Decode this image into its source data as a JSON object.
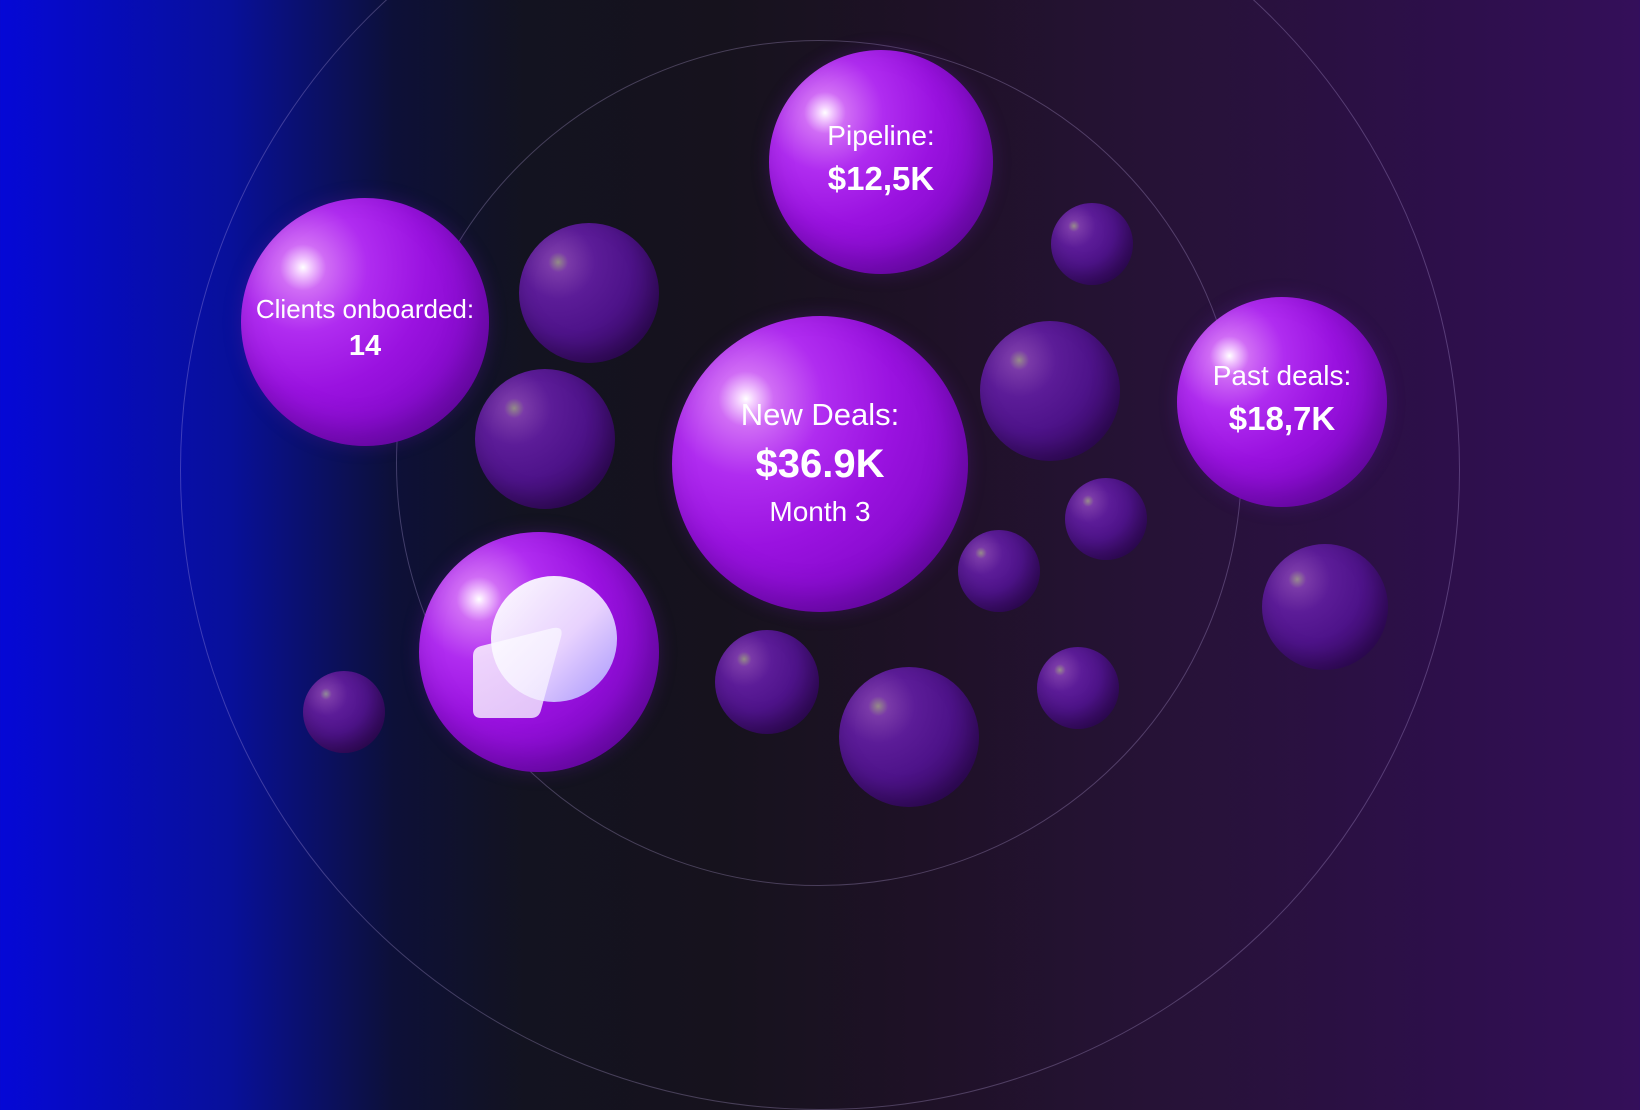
{
  "stats": {
    "new_deals": {
      "label": "New Deals:",
      "value": "$36.9K",
      "sub": "Month 3"
    },
    "pipeline": {
      "label": "Pipeline:",
      "value": "$12,5K"
    },
    "clients": {
      "label": "Clients onboarded:",
      "value": "14"
    },
    "past_deals": {
      "label": "Past deals:",
      "value": "$18,7K"
    }
  },
  "logo": {
    "icon": "brand-logo-icon"
  },
  "colors": {
    "background_left": "#0508d6",
    "background_mid": "#16121d",
    "background_right": "#340f5a",
    "sphere_accent": "#9a12e0",
    "sphere_small": "#4e138a"
  }
}
